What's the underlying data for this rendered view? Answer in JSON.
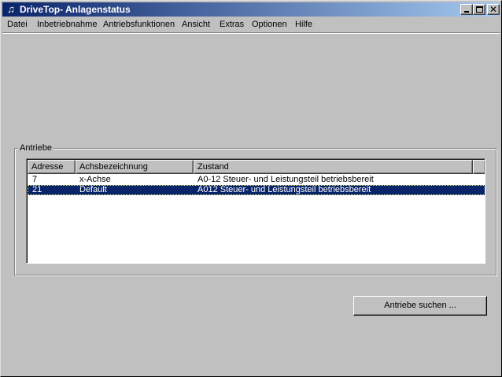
{
  "window": {
    "title": "DriveTop- Anlagenstatus",
    "app_icon": "music-note-icon"
  },
  "menu": {
    "items": [
      "Datei",
      "Inbetriebnahme",
      "Antriebsfunktionen",
      "Ansicht",
      "Extras",
      "Optionen",
      "Hilfe"
    ]
  },
  "group": {
    "label": "Antriebe"
  },
  "table": {
    "columns": [
      "Adresse",
      "Achsbezeichnung",
      "Zustand"
    ],
    "rows": [
      {
        "adresse": "7",
        "achse": "x-Achse",
        "zustand": "A0-12 Steuer- und Leistungsteil betriebsbereit",
        "selected": false
      },
      {
        "adresse": "21",
        "achse": "Default",
        "zustand": "A012 Steuer- und Leistungsteil betriebsbereit",
        "selected": true
      }
    ]
  },
  "buttons": {
    "search_label": "Antriebe suchen ..."
  },
  "colors": {
    "titlebar": "#0a246a",
    "face": "#c0c0c0",
    "selection": "#0a246a"
  }
}
